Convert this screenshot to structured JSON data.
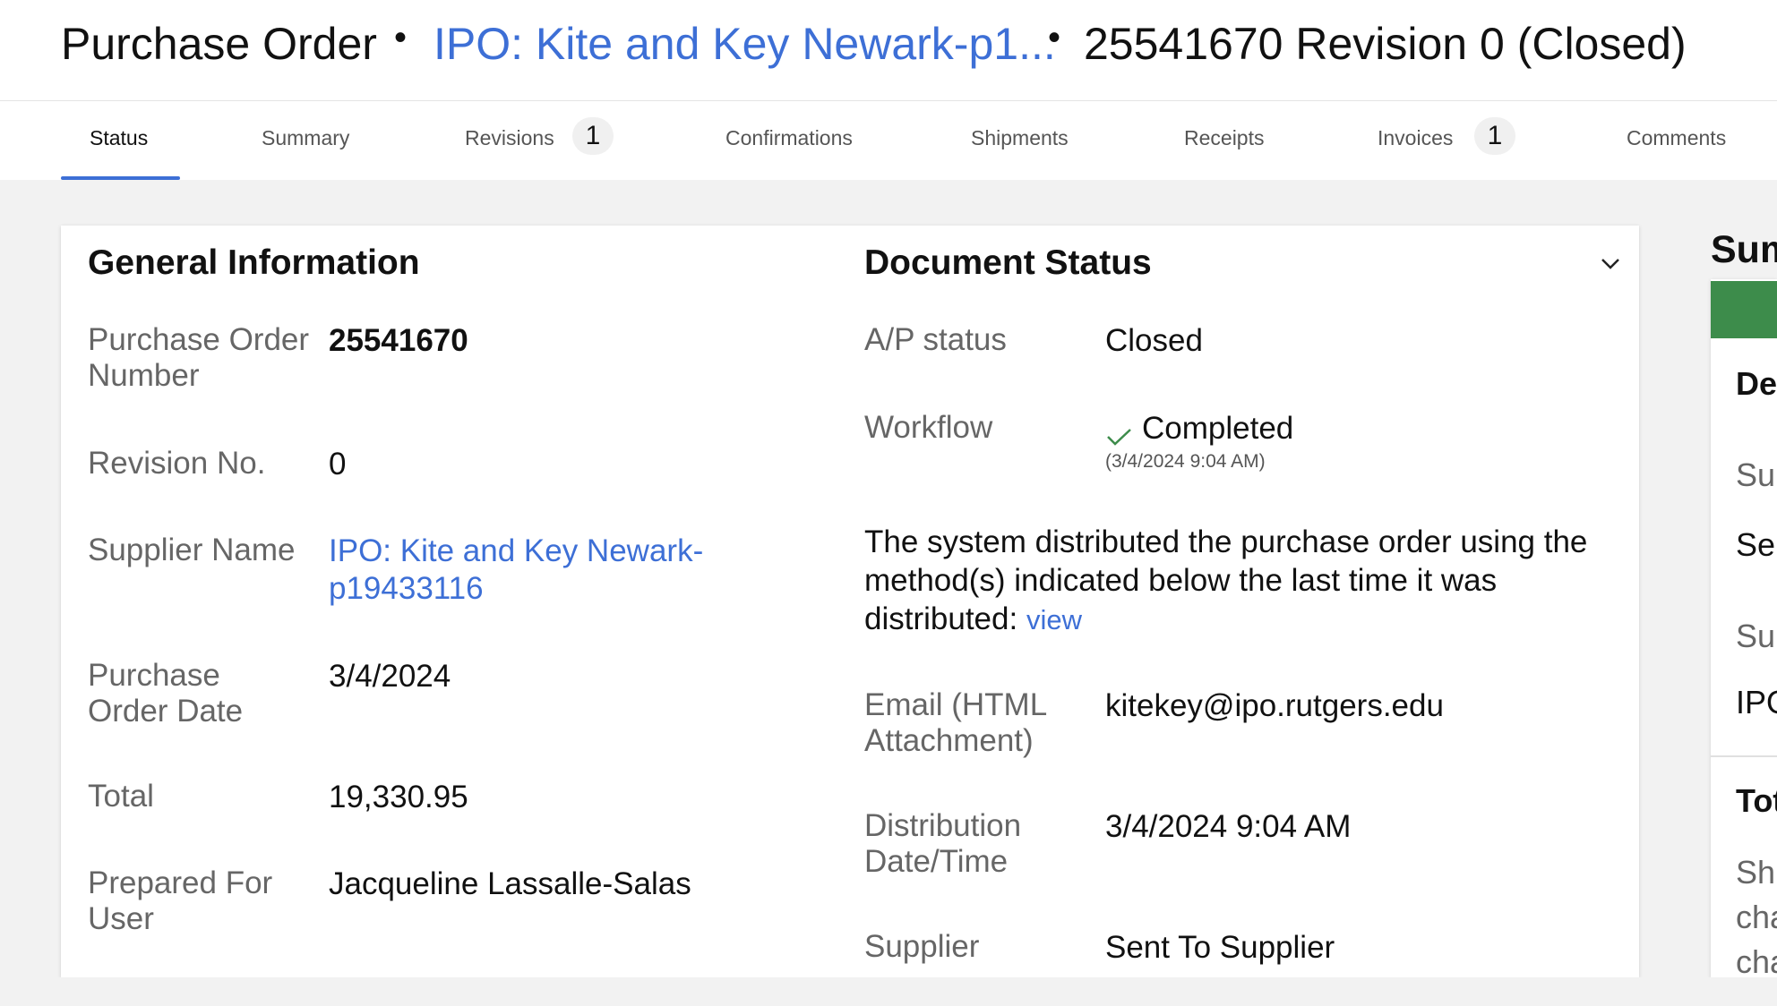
{
  "header": {
    "title": "Purchase Order",
    "separator": "•",
    "supplier_link": "IPO: Kite and Key Newark-p1...",
    "document": "25541670 Revision 0 (Closed)"
  },
  "tabs": [
    {
      "label": "Status",
      "active": true
    },
    {
      "label": "Summary"
    },
    {
      "label": "Revisions",
      "badge": "1"
    },
    {
      "label": "Confirmations"
    },
    {
      "label": "Shipments"
    },
    {
      "label": "Receipts"
    },
    {
      "label": "Invoices",
      "badge": "1"
    },
    {
      "label": "Comments"
    }
  ],
  "general": {
    "title": "General Information",
    "po_number_label": "Purchase Order Number",
    "po_number": "25541670",
    "revision_label": "Revision No.",
    "revision": "0",
    "supplier_label": "Supplier Name",
    "supplier_line1": "IPO: Kite and Key Newark-",
    "supplier_line2": "p19433116",
    "date_label": "Purchase Order Date",
    "date": "3/4/2024",
    "total_label": "Total",
    "total": "19,330.95",
    "prepared_label": "Prepared For User",
    "prepared": "Jacqueline Lassalle-Salas"
  },
  "doc_status": {
    "title": "Document Status",
    "ap_label": "A/P status",
    "ap_value": "Closed",
    "workflow_label": "Workflow",
    "workflow_value": "Completed",
    "workflow_time": "(3/4/2024 9:04 AM)",
    "distribution_text": "The system distributed the purchase order using the method(s) indicated below the last time it was distributed:",
    "view_link": "view",
    "email_label": "Email (HTML Attachment)",
    "email_value": "kitekey@ipo.rutgers.edu",
    "dist_label": "Distribution Date/Time",
    "dist_value": "3/4/2024 9:04 AM",
    "supplier_label": "Supplier",
    "supplier_value": "Sent To Supplier",
    "check_color": "#3d8c4b"
  },
  "side": {
    "head": "Sum",
    "t1": "De",
    "t2": "Su",
    "t3": "Se",
    "t4": "Su",
    "t5": "IPO",
    "t6": "Tot",
    "t7": "Sh",
    "t8": "cha",
    "t9": "cha",
    "bar_color": "#3d8c4b"
  }
}
